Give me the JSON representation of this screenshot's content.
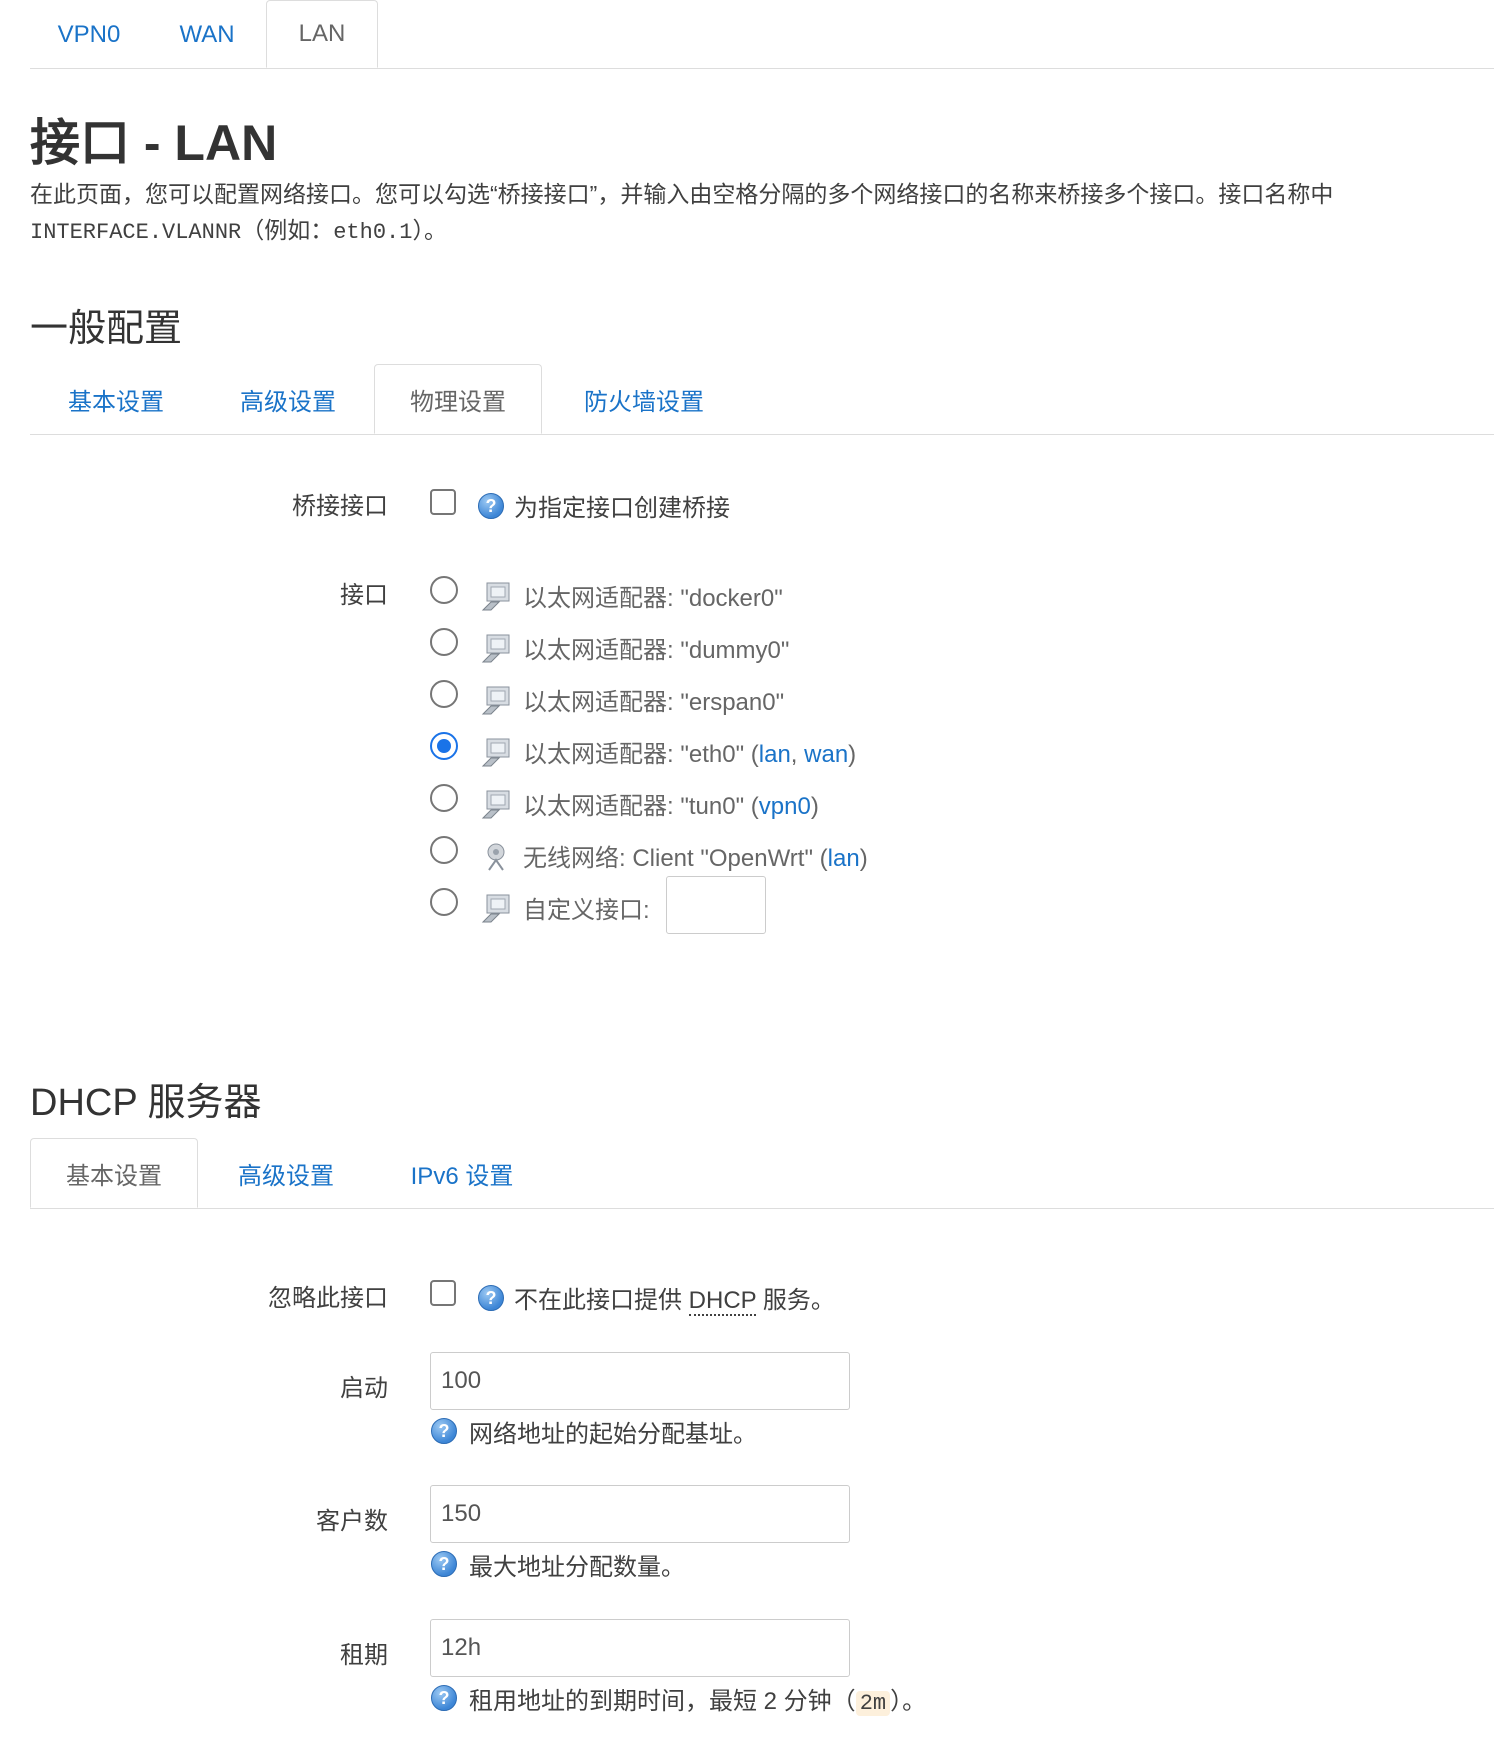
{
  "top_tabs": [
    "VPN0",
    "WAN",
    "LAN"
  ],
  "page_title": "接口 - LAN",
  "description": {
    "line1": "在此页面，您可以配置网络接口。您可以勾选“桥接接口”，并输入由空格分隔的多个网络接口的名称来桥接多个接口。接口名称中",
    "line2_code": "INTERFACE.VLANNR",
    "line2_rest": "（例如：",
    "line2_example": "eth0.1",
    "line2_end": "）。"
  },
  "general": {
    "heading": "一般配置",
    "tabs": [
      "基本设置",
      "高级设置",
      "物理设置",
      "防火墙设置"
    ],
    "bridge_label": "桥接接口",
    "bridge_help": "为指定接口创建桥接",
    "interface_label": "接口",
    "options": [
      {
        "text": "以太网适配器: \"docker0\"",
        "links": []
      },
      {
        "text": "以太网适配器: \"dummy0\"",
        "links": []
      },
      {
        "text": "以太网适配器: \"erspan0\"",
        "links": []
      },
      {
        "text": "以太网适配器: \"eth0\"",
        "links": [
          "lan",
          "wan"
        ]
      },
      {
        "text": "以太网适配器: \"tun0\"",
        "links": [
          "vpn0"
        ]
      },
      {
        "text": "无线网络: Client \"OpenWrt\"",
        "links": [
          "lan"
        ]
      },
      {
        "text": "自定义接口:",
        "links": []
      }
    ],
    "selected_option": "以太网适配器: \"eth0\""
  },
  "dhcp": {
    "heading": "DHCP 服务器",
    "tabs": [
      "基本设置",
      "高级设置",
      "IPv6 设置"
    ],
    "ignore_label": "忽略此接口",
    "ignore_help_a": "不在此接口提供",
    "ignore_help_abbr": "DHCP",
    "ignore_help_b": "服务。",
    "start_label": "启动",
    "start_value": "100",
    "start_help": "网络地址的起始分配基址。",
    "limit_label": "客户数",
    "limit_value": "150",
    "limit_help": "最大地址分配数量。",
    "lease_label": "租期",
    "lease_value": "12h",
    "lease_help_a": "租用地址的到期时间，最短 2 分钟（",
    "lease_help_code": "2m",
    "lease_help_b": "）。"
  },
  "colors": {
    "link": "#1a73c8",
    "radio_checked": "#1a73e8",
    "code_bg": "#fdf0dc"
  }
}
